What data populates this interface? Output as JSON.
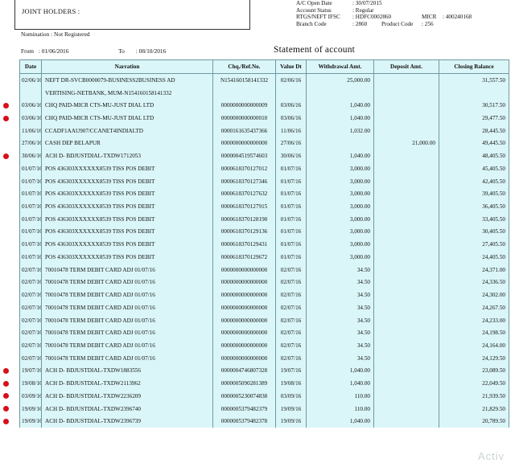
{
  "header": {
    "joint_holders_label": "JOINT HOLDERS :",
    "account_info": [
      {
        "key": "A/C Open Date",
        "value": ":  30/07/2015"
      },
      {
        "key": "Account Status",
        "value": ":  Regular"
      },
      {
        "key": "RTGS/NEFT IFSC",
        "value": ":  HDFC0002860",
        "extra_key": "MICR",
        "extra_value": ":  400240168"
      },
      {
        "key": "Branch Code",
        "value": ":  2860",
        "extra_key": "Product Code",
        "extra_value": ":  256"
      }
    ],
    "nomination": "Nomination :  Not Registered",
    "from_label": "From",
    "from_date": ":  01/06/2016",
    "to_label": "To",
    "to_date": ":  08/10/2016"
  },
  "statement_title": "Statement of account",
  "columns": [
    "Date",
    "Narration",
    "Chq./Ref.No.",
    "Value Dt",
    "Withdrawal Amt.",
    "Deposit Amt.",
    "Closing Balance"
  ],
  "rows": [
    {
      "date": "02/06/16",
      "narr": "NEFT DR-SVCB0000079-BUSINESS2BUSINESS AD",
      "chq": "N154160158141332",
      "val": "02/06/16",
      "wd": "25,000.00",
      "dep": "",
      "bal": "31,557.50",
      "mark": false
    },
    {
      "date": "",
      "narr": "VERTISING-NETBANK, MUM-N154160158141332",
      "chq": "",
      "val": "",
      "wd": "",
      "dep": "",
      "bal": "",
      "mark": false
    },
    {
      "date": "03/06/16",
      "narr": "CHQ PAID-MICR CTS-MU-JUST DIAL LTD",
      "chq": "0000000000000009",
      "val": "03/06/16",
      "wd": "1,040.00",
      "dep": "",
      "bal": "30,517.50",
      "mark": true
    },
    {
      "date": "03/06/16",
      "narr": "CHQ PAID-MICR CTS-MU-JUST DIAL LTD",
      "chq": "0000000000000010",
      "val": "03/06/16",
      "wd": "1,040.00",
      "dep": "",
      "bal": "29,477.50",
      "mark": true
    },
    {
      "date": "11/06/16",
      "narr": "CCADF1AAU907/CCANET4INDIALTD",
      "chq": "0000161635437366",
      "val": "11/06/16",
      "wd": "1,032.00",
      "dep": "",
      "bal": "28,445.50",
      "mark": false
    },
    {
      "date": "27/06/16",
      "narr": "CASH DEP BELAPUR",
      "chq": "0000000000000000",
      "val": "27/06/16",
      "wd": "",
      "dep": "21,000.00",
      "bal": "49,445.50",
      "mark": false
    },
    {
      "date": "30/06/16",
      "narr": "ACH D- BDJUSTDIAL-TXDW1712053",
      "chq": "0000004519574603",
      "val": "30/06/16",
      "wd": "1,040.00",
      "dep": "",
      "bal": "48,405.50",
      "mark": true
    },
    {
      "date": "01/07/16",
      "narr": "POS 436303XXXXXX8539 TISS POS DEBIT",
      "chq": "0000618370127012",
      "val": "01/07/16",
      "wd": "3,000.00",
      "dep": "",
      "bal": "45,405.50",
      "mark": false
    },
    {
      "date": "01/07/16",
      "narr": "POS 436303XXXXXX8539 TISS POS DEBIT",
      "chq": "0000618370127346",
      "val": "01/07/16",
      "wd": "3,000.00",
      "dep": "",
      "bal": "42,405.50",
      "mark": false
    },
    {
      "date": "01/07/16",
      "narr": "POS 436303XXXXXX8539 TISS POS DEBIT",
      "chq": "0000618370127632",
      "val": "01/07/16",
      "wd": "3,000.00",
      "dep": "",
      "bal": "39,405.50",
      "mark": false
    },
    {
      "date": "01/07/16",
      "narr": "POS 436303XXXXXX8539 TISS POS DEBIT",
      "chq": "0000618370127915",
      "val": "01/07/16",
      "wd": "3,000.00",
      "dep": "",
      "bal": "36,405.50",
      "mark": false
    },
    {
      "date": "01/07/16",
      "narr": "POS 436303XXXXXX8539 TISS POS DEBIT",
      "chq": "0000618370128190",
      "val": "01/07/16",
      "wd": "3,000.00",
      "dep": "",
      "bal": "33,405.50",
      "mark": false
    },
    {
      "date": "01/07/16",
      "narr": "POS 436303XXXXXX8539 TISS POS DEBIT",
      "chq": "0000618370129136",
      "val": "01/07/16",
      "wd": "3,000.00",
      "dep": "",
      "bal": "30,405.50",
      "mark": false
    },
    {
      "date": "01/07/16",
      "narr": "POS 436303XXXXXX8539 TISS POS DEBIT",
      "chq": "0000618370129431",
      "val": "01/07/16",
      "wd": "3,000.00",
      "dep": "",
      "bal": "27,405.50",
      "mark": false
    },
    {
      "date": "01/07/16",
      "narr": "POS 436303XXXXXX8539 TISS POS DEBIT",
      "chq": "0000618370129672",
      "val": "01/07/16",
      "wd": "3,000.00",
      "dep": "",
      "bal": "24,405.50",
      "mark": false
    },
    {
      "date": "02/07/16",
      "narr": "70010478 TERM DEBIT CARD ADJ 01/07/16",
      "chq": "0000000000000000",
      "val": "02/07/16",
      "wd": "34.50",
      "dep": "",
      "bal": "24,371.00",
      "mark": false
    },
    {
      "date": "02/07/16",
      "narr": "70010478 TERM DEBIT CARD ADJ 01/07/16",
      "chq": "0000000000000000",
      "val": "02/07/16",
      "wd": "34.50",
      "dep": "",
      "bal": "24,336.50",
      "mark": false
    },
    {
      "date": "02/07/16",
      "narr": "70010478 TERM DEBIT CARD ADJ 01/07/16",
      "chq": "0000000000000000",
      "val": "02/07/16",
      "wd": "34.50",
      "dep": "",
      "bal": "24,302.00",
      "mark": false
    },
    {
      "date": "02/07/16",
      "narr": "70010478 TERM DEBIT CARD ADJ 01/07/16",
      "chq": "0000000000000000",
      "val": "02/07/16",
      "wd": "34.50",
      "dep": "",
      "bal": "24,267.50",
      "mark": false
    },
    {
      "date": "02/07/16",
      "narr": "70010478 TERM DEBIT CARD ADJ 01/07/16",
      "chq": "0000000000000000",
      "val": "02/07/16",
      "wd": "34.50",
      "dep": "",
      "bal": "24,233.00",
      "mark": false
    },
    {
      "date": "02/07/16",
      "narr": "70010478 TERM DEBIT CARD ADJ 01/07/16",
      "chq": "0000000000000000",
      "val": "02/07/16",
      "wd": "34.50",
      "dep": "",
      "bal": "24,198.50",
      "mark": false
    },
    {
      "date": "02/07/16",
      "narr": "70010478 TERM DEBIT CARD ADJ 01/07/16",
      "chq": "0000000000000000",
      "val": "02/07/16",
      "wd": "34.50",
      "dep": "",
      "bal": "24,164.00",
      "mark": false
    },
    {
      "date": "02/07/16",
      "narr": "70010478 TERM DEBIT CARD ADJ 01/07/16",
      "chq": "0000000000000000",
      "val": "02/07/16",
      "wd": "34.50",
      "dep": "",
      "bal": "24,129.50",
      "mark": false
    },
    {
      "date": "19/07/16",
      "narr": "ACH D- BDJUSTDIAL-TXDW1883556",
      "chq": "0000004746807328",
      "val": "19/07/16",
      "wd": "1,040.00",
      "dep": "",
      "bal": "23,089.50",
      "mark": true
    },
    {
      "date": "19/08/16",
      "narr": "ACH D- BDJUSTDIAL-TXDW2113962",
      "chq": "0000005090281389",
      "val": "19/08/16",
      "wd": "1,040.00",
      "dep": "",
      "bal": "22,049.50",
      "mark": true
    },
    {
      "date": "03/09/16",
      "narr": "ACH D- BDJUSTDIAL-TXDW2236209",
      "chq": "0000005230074838",
      "val": "03/09/16",
      "wd": "110.00",
      "dep": "",
      "bal": "21,939.50",
      "mark": true
    },
    {
      "date": "19/09/16",
      "narr": "ACH D- BDJUSTDIAL-TXDW2396740",
      "chq": "0000005379482379",
      "val": "19/09/16",
      "wd": "110.00",
      "dep": "",
      "bal": "21,829.50",
      "mark": true
    },
    {
      "date": "19/09/16",
      "narr": "ACH D- BDJUSTDIAL-TXDW2396739",
      "chq": "0000005379482378",
      "val": "19/09/16",
      "wd": "1,040.00",
      "dep": "",
      "bal": "20,789.50",
      "mark": true
    }
  ],
  "watermark": "Activ"
}
